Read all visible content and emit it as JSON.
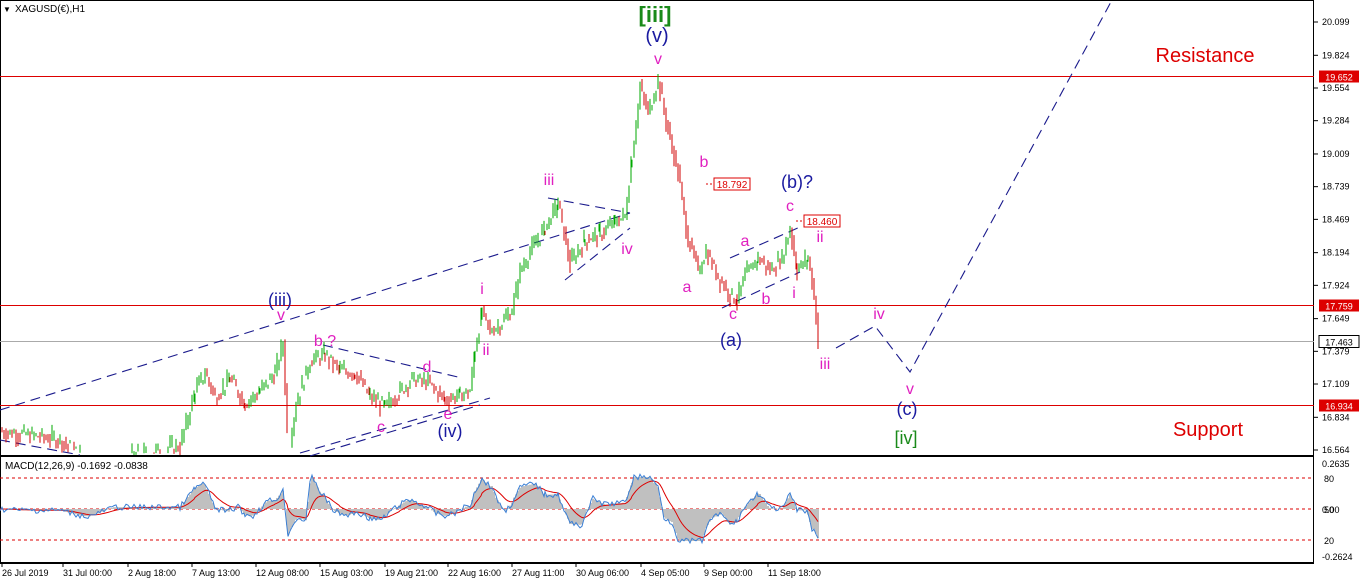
{
  "header": {
    "symbol": "XAGUSD(€),H1"
  },
  "colors": {
    "bull": "#00aa00",
    "bear": "#d00000",
    "hline": "#dd0000",
    "current_line": "#aaaaaa",
    "trend": "#1a1a8c",
    "wave_pink": "#e020c0",
    "wave_navy": "#1a1aa0",
    "wave_green": "#1a8a1a",
    "zone": "#dd0000",
    "macd_hist": "#c0c0c0",
    "macd_signal": "#dd0000",
    "macd_line": "#3a7fd5"
  },
  "chart_data": [
    {
      "type": "candlestick",
      "title": "XAGUSD(€),H1",
      "ylim": [
        16.5,
        20.2
      ],
      "price_ticks": [
        "20.099",
        "19.824",
        "19.554",
        "19.284",
        "19.009",
        "18.739",
        "18.469",
        "18.194",
        "17.924",
        "17.649",
        "17.379",
        "17.109",
        "16.834",
        "16.564"
      ],
      "x_tick_labels": [
        "26 Jul 2019",
        "31 Jul 00:00",
        "2 Aug 18:00",
        "7 Aug 13:00",
        "12 Aug 08:00",
        "15 Aug 03:00",
        "19 Aug 21:00",
        "22 Aug 16:00",
        "27 Aug 11:00",
        "30 Aug 06:00",
        "4 Sep 05:00",
        "9 Sep 00:00",
        "11 Sep 18:00"
      ],
      "horizontal_levels": [
        {
          "price": 19.652,
          "label": "19.652",
          "style": "solid"
        },
        {
          "price": 17.759,
          "label": "17.759",
          "style": "solid"
        },
        {
          "price": 16.934,
          "label": "16.934",
          "style": "solid"
        },
        {
          "price": 17.463,
          "label": "17.463",
          "style": "current"
        }
      ],
      "price_path": [
        [
          0,
          16.72
        ],
        [
          60,
          16.65
        ],
        [
          90,
          16.45
        ],
        [
          180,
          16.6
        ],
        [
          195,
          17.05
        ],
        [
          205,
          17.2
        ],
        [
          215,
          17.0
        ],
        [
          230,
          17.15
        ],
        [
          245,
          16.95
        ],
        [
          260,
          17.05
        ],
        [
          275,
          17.2
        ],
        [
          283,
          17.45
        ],
        [
          288,
          16.55
        ],
        [
          296,
          16.95
        ],
        [
          310,
          17.3
        ],
        [
          325,
          17.35
        ],
        [
          340,
          17.22
        ],
        [
          355,
          17.2
        ],
        [
          370,
          17.0
        ],
        [
          385,
          16.92
        ],
        [
          400,
          17.05
        ],
        [
          412,
          17.15
        ],
        [
          428,
          17.12
        ],
        [
          445,
          16.98
        ],
        [
          460,
          17.02
        ],
        [
          470,
          17.05
        ],
        [
          475,
          17.4
        ],
        [
          482,
          17.7
        ],
        [
          490,
          17.55
        ],
        [
          500,
          17.6
        ],
        [
          512,
          17.72
        ],
        [
          520,
          18.05
        ],
        [
          530,
          18.2
        ],
        [
          545,
          18.4
        ],
        [
          558,
          18.6
        ],
        [
          570,
          18.1
        ],
        [
          585,
          18.3
        ],
        [
          600,
          18.35
        ],
        [
          615,
          18.45
        ],
        [
          625,
          18.5
        ],
        [
          632,
          19.0
        ],
        [
          640,
          19.55
        ],
        [
          648,
          19.35
        ],
        [
          658,
          19.62
        ],
        [
          668,
          19.2
        ],
        [
          678,
          18.85
        ],
        [
          688,
          18.3
        ],
        [
          698,
          18.05
        ],
        [
          706,
          18.2
        ],
        [
          718,
          18.0
        ],
        [
          730,
          17.85
        ],
        [
          737,
          17.8
        ],
        [
          745,
          18.0
        ],
        [
          758,
          18.15
        ],
        [
          770,
          18.05
        ],
        [
          782,
          18.15
        ],
        [
          790,
          18.4
        ],
        [
          797,
          18.05
        ],
        [
          808,
          18.15
        ],
        [
          814,
          17.85
        ],
        [
          818,
          17.45
        ]
      ],
      "annotations": [
        {
          "text": "[iii]",
          "level": "primary"
        },
        {
          "text": "(v)",
          "level": "intermediate"
        },
        {
          "text": "v",
          "level": "minor"
        },
        {
          "text": "iii",
          "level": "minor"
        },
        {
          "text": "iv",
          "level": "minor"
        },
        {
          "text": "i",
          "level": "minor"
        },
        {
          "text": "ii",
          "level": "minor"
        },
        {
          "text": "(iii)",
          "level": "intermediate"
        },
        {
          "text": "v",
          "level": "minor"
        },
        {
          "text": "b ?",
          "level": "minor"
        },
        {
          "text": "d",
          "level": "minor"
        },
        {
          "text": "c",
          "level": "minor"
        },
        {
          "text": "e",
          "level": "minor"
        },
        {
          "text": "(iv)",
          "level": "intermediate"
        },
        {
          "text": "b",
          "level": "minor"
        },
        {
          "text": "18.792",
          "level": "price-box"
        },
        {
          "text": "a",
          "level": "minor"
        },
        {
          "text": "a",
          "level": "minor"
        },
        {
          "text": "c",
          "level": "minor"
        },
        {
          "text": "(a)",
          "level": "intermediate"
        },
        {
          "text": "b",
          "level": "minor"
        },
        {
          "text": "(b)?",
          "level": "intermediate"
        },
        {
          "text": "c",
          "level": "minor"
        },
        {
          "text": "18.460",
          "level": "price-box"
        },
        {
          "text": "i",
          "level": "minor"
        },
        {
          "text": "ii",
          "level": "minor"
        },
        {
          "text": "iii",
          "level": "minor"
        },
        {
          "text": "iv",
          "level": "minor"
        },
        {
          "text": "v",
          "level": "minor"
        },
        {
          "text": "(c)",
          "level": "intermediate"
        },
        {
          "text": "[iv]",
          "level": "primary"
        },
        {
          "text": "Resistance",
          "level": "zone"
        },
        {
          "text": "Support",
          "level": "zone"
        }
      ]
    },
    {
      "type": "macd",
      "title": "MACD(12,26,9) -0.1692 -0.0838",
      "right_tick_labels": [
        "0.2635",
        "80",
        "50",
        "0.00",
        "20",
        "-0.2624"
      ],
      "current_values": {
        "macd": -0.1692,
        "signal": -0.0838
      }
    }
  ]
}
